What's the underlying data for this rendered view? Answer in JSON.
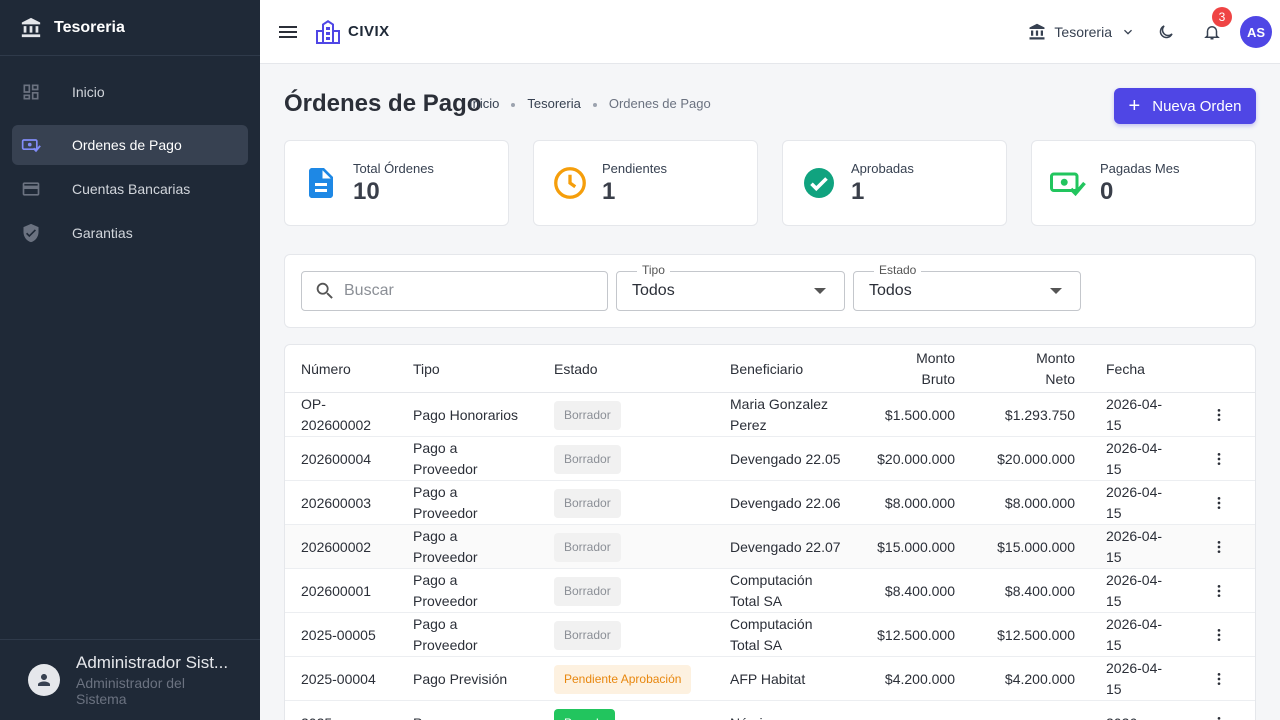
{
  "sidebar": {
    "title": "Tesoreria",
    "items": [
      {
        "label": "Inicio",
        "icon": "dashboard-icon"
      },
      {
        "label": "Ordenes de Pago",
        "icon": "payment-icon"
      },
      {
        "label": "Cuentas Bancarias",
        "icon": "credit-card-icon"
      },
      {
        "label": "Garantias",
        "icon": "shield-icon"
      }
    ],
    "user": {
      "name": "Administrador Sist...",
      "role": "Administrador del Sistema"
    }
  },
  "topbar": {
    "brand": "CIVIX",
    "module": "Tesoreria",
    "notifications": "3",
    "avatar_initials": "AS"
  },
  "page": {
    "title": "Órdenes de Pago",
    "breadcrumb": [
      "Inicio",
      "Tesoreria",
      "Ordenes de Pago"
    ],
    "new_button": "Nueva Orden"
  },
  "stats": [
    {
      "label": "Total Órdenes",
      "value": "10",
      "icon": "document-icon",
      "color": "#1e88e5"
    },
    {
      "label": "Pendientes",
      "value": "1",
      "icon": "clock-icon",
      "color": "#f59e0b"
    },
    {
      "label": "Aprobadas",
      "value": "1",
      "icon": "check-circle-icon",
      "color": "#10a37f"
    },
    {
      "label": "Pagadas Mes",
      "value": "0",
      "icon": "paid-cash-icon",
      "color": "#22c55e"
    }
  ],
  "filters": {
    "search_placeholder": "Buscar",
    "tipo_label": "Tipo",
    "tipo_value": "Todos",
    "estado_label": "Estado",
    "estado_value": "Todos"
  },
  "table": {
    "headers": [
      "Número",
      "Tipo",
      "Estado",
      "Beneficiario",
      "Monto Bruto",
      "Monto Neto",
      "Fecha"
    ],
    "rows": [
      {
        "numero": "OP-202600002",
        "tipo": "Pago Honorarios",
        "estado": "Borrador",
        "beneficiario": "Maria Gonzalez Perez",
        "bruto": "$1.500.000",
        "neto": "$1.293.750",
        "fecha": "2026-04-15"
      },
      {
        "numero": "202600004",
        "tipo": "Pago a Proveedor",
        "estado": "Borrador",
        "beneficiario": "Devengado 22.05",
        "bruto": "$20.000.000",
        "neto": "$20.000.000",
        "fecha": "2026-04-15"
      },
      {
        "numero": "202600003",
        "tipo": "Pago a Proveedor",
        "estado": "Borrador",
        "beneficiario": "Devengado 22.06",
        "bruto": "$8.000.000",
        "neto": "$8.000.000",
        "fecha": "2026-04-15"
      },
      {
        "numero": "202600002",
        "tipo": "Pago a Proveedor",
        "estado": "Borrador",
        "beneficiario": "Devengado 22.07",
        "bruto": "$15.000.000",
        "neto": "$15.000.000",
        "fecha": "2026-04-15"
      },
      {
        "numero": "202600001",
        "tipo": "Pago a Proveedor",
        "estado": "Borrador",
        "beneficiario": "Computación Total SA",
        "bruto": "$8.400.000",
        "neto": "$8.400.000",
        "fecha": "2026-04-15"
      },
      {
        "numero": "2025-00005",
        "tipo": "Pago a Proveedor",
        "estado": "Borrador",
        "beneficiario": "Computación Total SA",
        "bruto": "$12.500.000",
        "neto": "$12.500.000",
        "fecha": "2026-04-15"
      },
      {
        "numero": "2025-00004",
        "tipo": "Pago Previsión",
        "estado": "Pendiente Aprobación",
        "beneficiario": "AFP Habitat",
        "bruto": "$4.200.000",
        "neto": "$4.200.000",
        "fecha": "2026-04-15"
      },
      {
        "numero": "2025-",
        "tipo": "Pago",
        "estado": "Pagada",
        "beneficiario": "Nómina",
        "bruto": "",
        "neto": "",
        "fecha": "2026-"
      }
    ]
  }
}
